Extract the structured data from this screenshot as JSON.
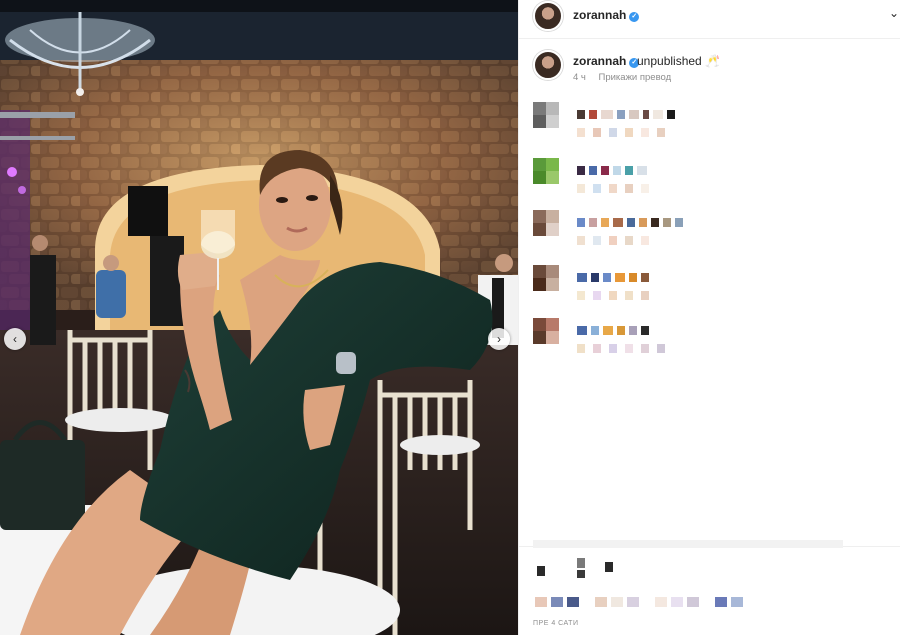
{
  "header": {
    "username": "zorannah",
    "verified_icon": "verified-badge-icon",
    "more_icon": "chevron-icon"
  },
  "caption": {
    "username": "zorannah",
    "text": "unpublished 🥂",
    "time": "4 ч",
    "translate": "Прикажи превод"
  },
  "nav": {
    "prev_icon": "‹",
    "next_icon": "›"
  },
  "footer": {
    "time_label": "ПРЕ 4 САТИ"
  },
  "colors": {
    "verified": "#3897f0",
    "muted": "#8e8e8e",
    "text": "#262626"
  }
}
